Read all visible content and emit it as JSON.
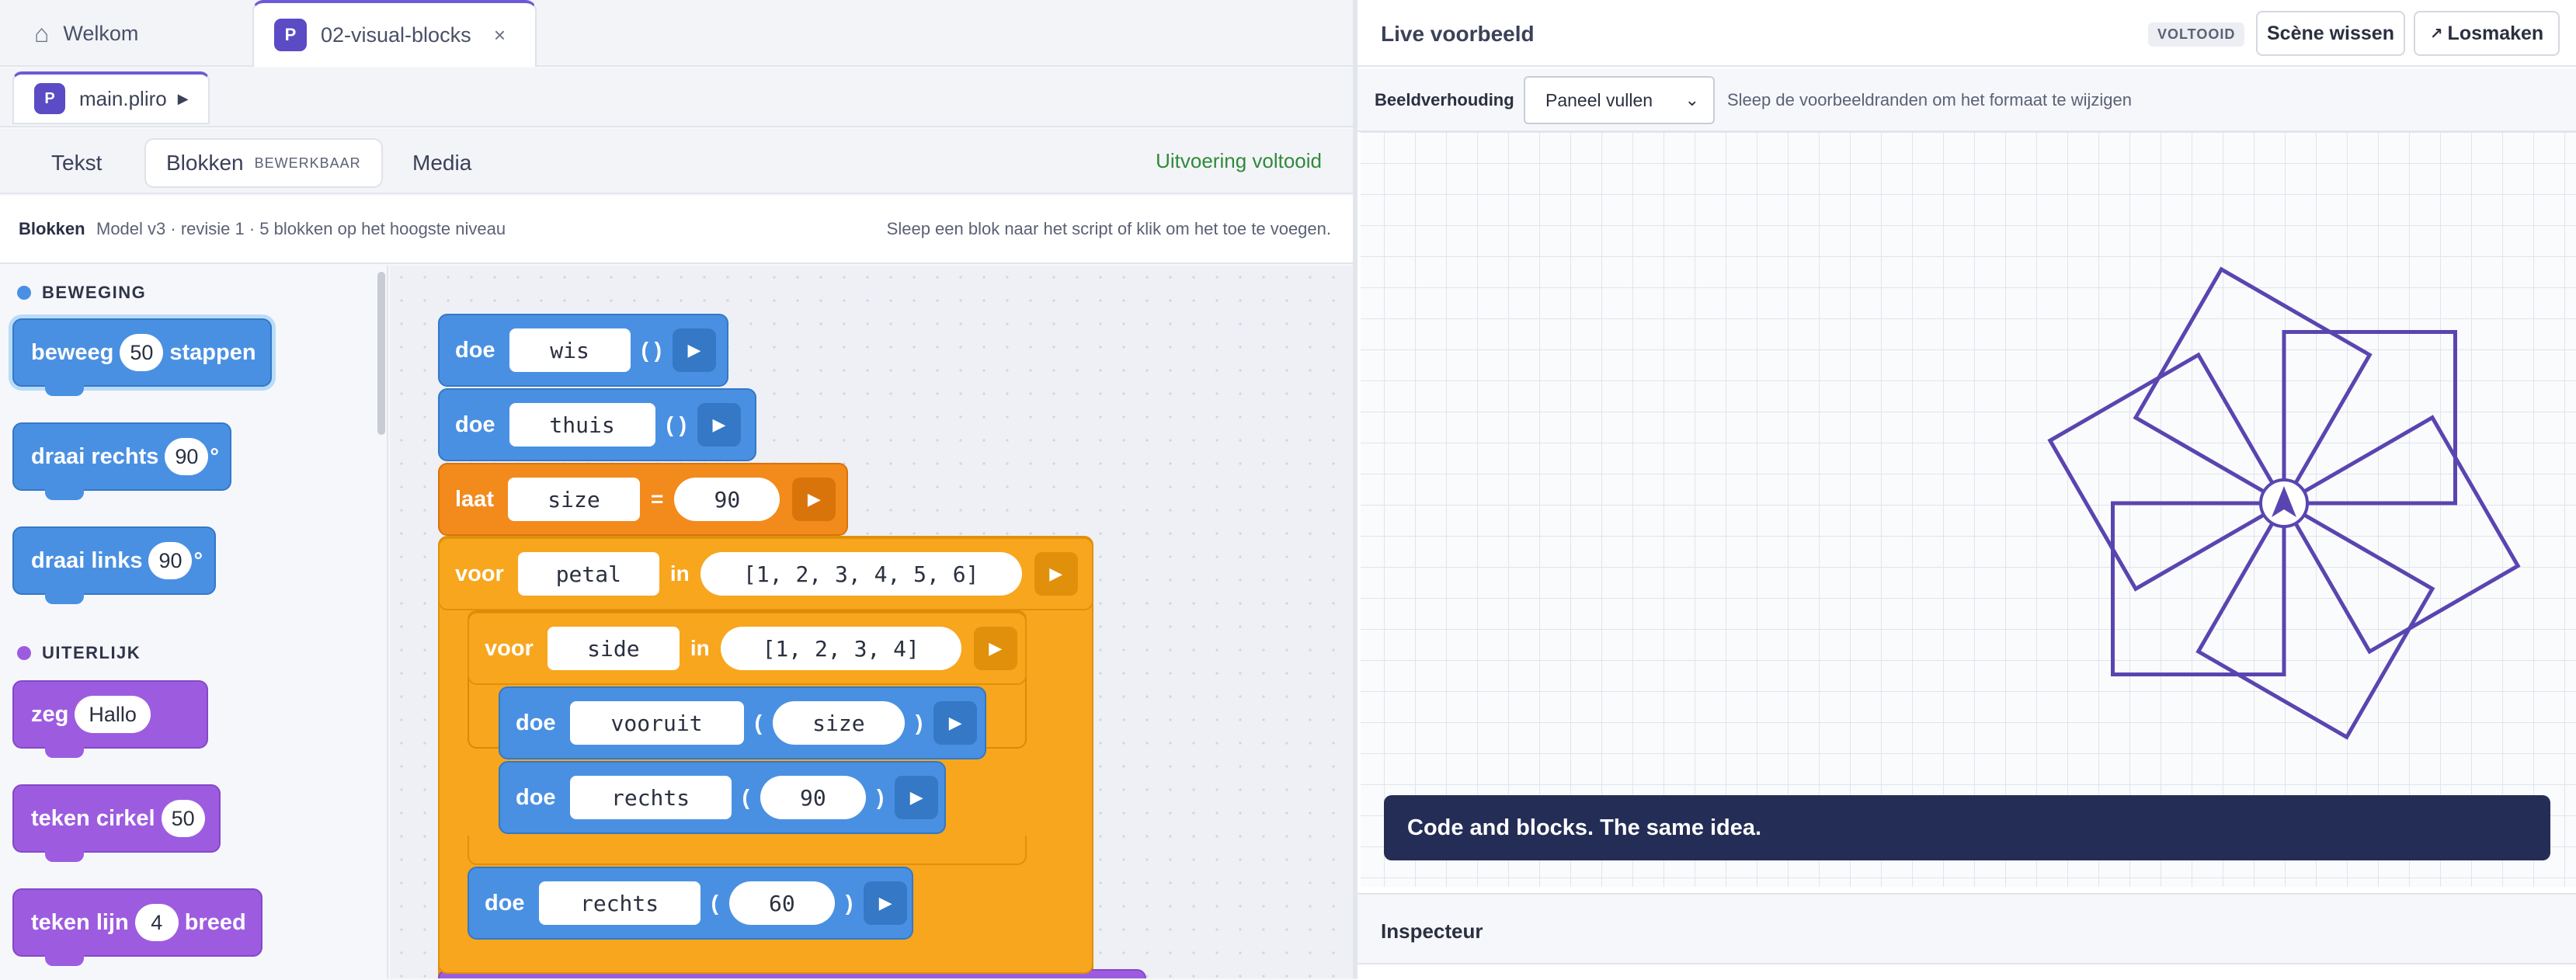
{
  "tabs": [
    {
      "label": "Welkom"
    },
    {
      "label": "02-visual-blocks",
      "badge": "P"
    }
  ],
  "file": {
    "name": "main.pliro",
    "badge": "P"
  },
  "modes": {
    "tekst": "Tekst",
    "blokken": "Blokken",
    "blokken_sub": "BEWERKBAAR",
    "media": "Media",
    "status": "Uitvoering voltooid"
  },
  "info": {
    "label": "Blokken",
    "meta": "Model v3 · revisie 1 · 5 blokken op het hoogste niveau",
    "hint": "Sleep een blok naar het script of klik om het toe te voegen."
  },
  "palette": {
    "categories": [
      {
        "name": "BEWEGING",
        "color": "#4a90e2"
      },
      {
        "name": "UITERLIJK",
        "color": "#9d5ce0"
      }
    ],
    "motion": [
      {
        "pre": "beweeg",
        "val": "50",
        "post": "stappen"
      },
      {
        "pre": "draai rechts",
        "val": "90",
        "post": "°"
      },
      {
        "pre": "draai links",
        "val": "90",
        "post": "°"
      }
    ],
    "looks": [
      {
        "pre": "zeg",
        "val": "Hallo",
        "post": ""
      },
      {
        "pre": "teken cirkel",
        "val": "50",
        "post": ""
      },
      {
        "pre": "teken lijn",
        "val": "4",
        "post": "breed"
      }
    ]
  },
  "script": {
    "b1": {
      "kw": "doe",
      "name": "wis",
      "args": "( )"
    },
    "b2": {
      "kw": "doe",
      "name": "thuis",
      "args": "( )"
    },
    "b3": {
      "kw": "laat",
      "name": "size",
      "eq": "=",
      "val": "90"
    },
    "b4": {
      "kw": "voor",
      "var": "petal",
      "in": "in",
      "list": "[1, 2, 3, 4, 5, 6]"
    },
    "b5": {
      "kw": "voor",
      "var": "side",
      "in": "in",
      "list": "[1, 2, 3, 4]"
    },
    "b6": {
      "kw": "doe",
      "name": "vooruit",
      "lp": "(",
      "arg": "size",
      "rp": ")"
    },
    "b7": {
      "kw": "doe",
      "name": "rechts",
      "lp": "(",
      "arg": "90",
      "rp": ")"
    },
    "b8": {
      "kw": "doe",
      "name": "rechts",
      "lp": "(",
      "arg": "60",
      "rp": ")"
    }
  },
  "preview": {
    "title": "Live voorbeeld",
    "status": "VOLTOOID",
    "clear_label": "Scène wissen",
    "detach_label": "Losmaken",
    "ratio_label": "Beeldverhouding",
    "ratio_value": "Paneel vullen",
    "ratio_options": [
      "Paneel vullen"
    ],
    "hint": "Sleep de voorbeeldranden om het formaat te wijzigen",
    "banner": "Code and blocks. The same idea.",
    "stroke_color": "#5a45b0",
    "drawing": {
      "petals": 6,
      "sides": 4,
      "size": 90,
      "turn_inner": 90,
      "turn_outer": 60
    }
  },
  "inspector": {
    "title": "Inspecteur"
  }
}
